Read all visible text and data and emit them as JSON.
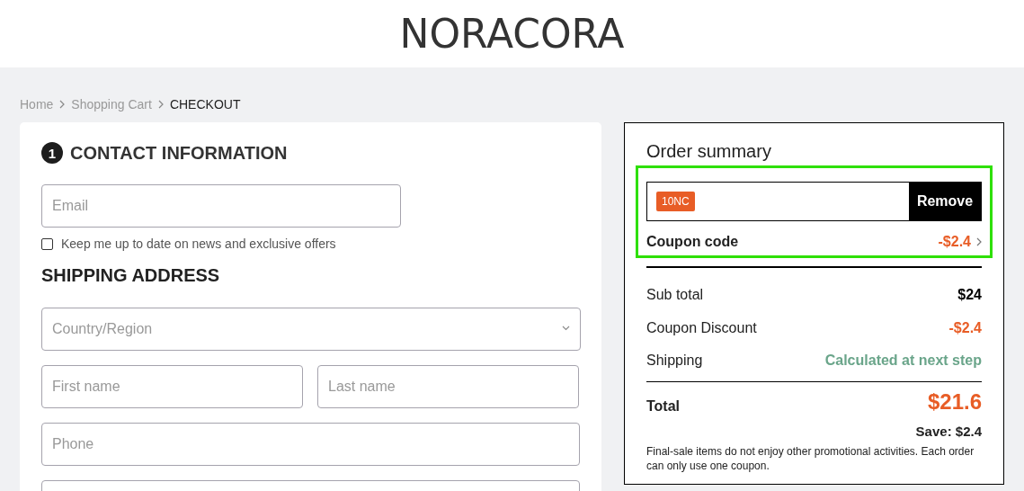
{
  "header": {
    "logo": "NORACORA"
  },
  "breadcrumb": [
    {
      "label": "Home",
      "current": false
    },
    {
      "label": "Shopping Cart",
      "current": false
    },
    {
      "label": "CHECKOUT",
      "current": true
    }
  ],
  "contact": {
    "step": "1",
    "title": "CONTACT INFORMATION",
    "email": {
      "placeholder": "Email"
    },
    "newsletter": {
      "label": "Keep me up to date on news and exclusive offers",
      "checked": false
    }
  },
  "shipping": {
    "title": "SHIPPING ADDRESS",
    "fields": [
      {
        "placeholder": "Country/Region",
        "kind": "select"
      },
      {
        "placeholder": "First name",
        "kind": "half"
      },
      {
        "placeholder": "Last name",
        "kind": "half"
      },
      {
        "placeholder": "Phone",
        "kind": "text"
      },
      {
        "kind": "text"
      }
    ]
  },
  "summary": {
    "title": "Order summary",
    "highlighted": true,
    "coupon": {
      "code": "10NC",
      "button": "Remove",
      "label": "Coupon code",
      "amount": "-$2.4"
    },
    "rows": [
      {
        "label": "Sub total",
        "value": "$24",
        "kind": "plain"
      },
      {
        "label": "Coupon Discount",
        "value": "-$2.4",
        "kind": "discount"
      },
      {
        "label": "Shipping",
        "value": "Calculated at next step",
        "kind": "info"
      }
    ],
    "total": {
      "label": "Total",
      "value": "$21.6",
      "save": "Save: $2.4"
    },
    "note": "Final-sale items do not enjoy other promotional activities. Each order can only use one coupon."
  }
}
